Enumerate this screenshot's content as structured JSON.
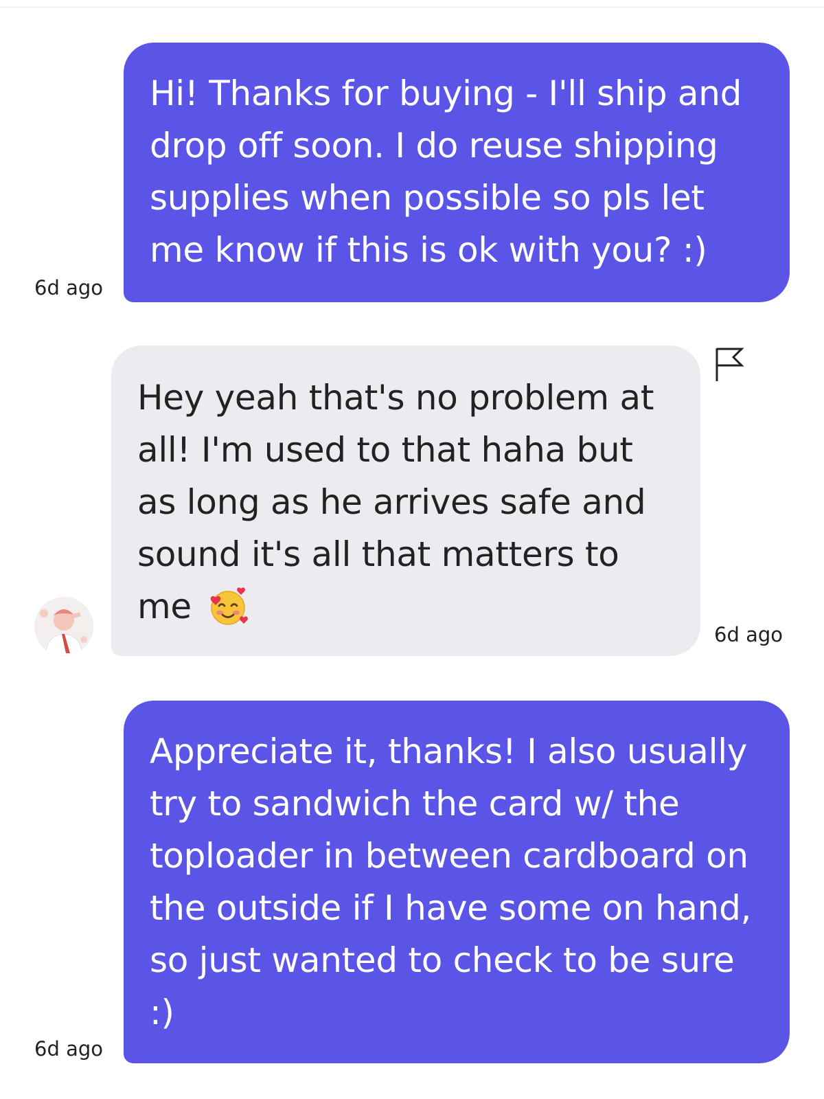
{
  "messages": [
    {
      "sender": "me",
      "text": "Hi! Thanks for buying - I'll ship and drop off soon. I do reuse shipping supplies when possible so pls let me know if this is ok with you? :)",
      "time": "6d ago"
    },
    {
      "sender": "buyer",
      "text": "Hey yeah that's no problem at all! I'm used to that haha but as long as he arrives safe and sound it's all that matters to me",
      "emoji": "smiling-face-with-hearts-icon",
      "time": "6d ago"
    },
    {
      "sender": "me",
      "text": "Appreciate it, thanks! I also usually try to sandwich the card w/ the toploader in between cardboard on the outside if I have some on hand, so just wanted to check to be sure :)",
      "time": "6d ago"
    }
  ],
  "icons": {
    "report": "flag-icon",
    "avatar": "avatar"
  },
  "colors": {
    "sent_bubble": "#5a55e6",
    "received_bubble": "#ececf0",
    "sent_text": "#ffffff",
    "received_text": "#222222"
  }
}
